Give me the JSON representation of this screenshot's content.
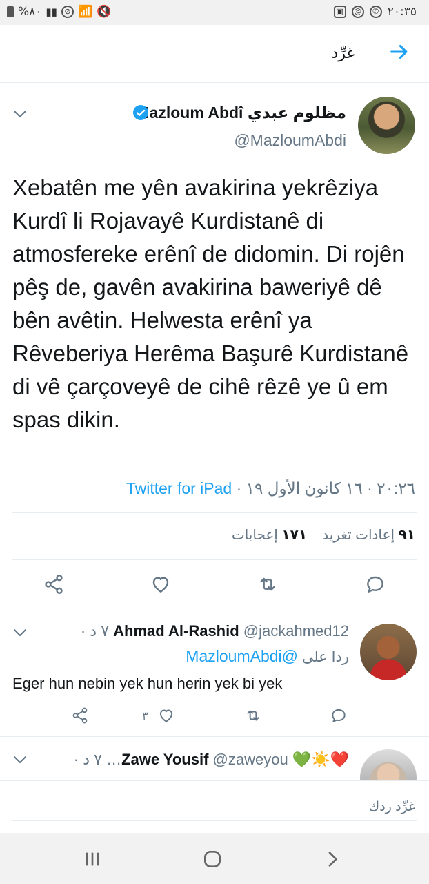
{
  "status_bar": {
    "time": "٢٠:٣٥",
    "battery": "%٨٠",
    "icons": [
      "battery-icon",
      "signal-icon",
      "dnd-icon",
      "wifi-icon",
      "mute-icon",
      "whatsapp-icon",
      "mail-icon",
      "image-icon"
    ]
  },
  "header": {
    "title": "غرِّد"
  },
  "tweet": {
    "author_name": "مظلوم عبدي Mazloum Abdî",
    "handle": "@MazloumAbdi",
    "verified": true,
    "text": "Xebatên me yên avakirina yekrêziya Kurdî li Rojavayê Kurdistanê di atmosfereke erênî de didomin. Di rojên pêş de, gavên avakirina baweriyê dê bên avêtin. Helwesta erênî ya Rêveberiya Herêma Başurê Kurdistanê di vê çarçoveyê de cihê rêzê ye û em spas dikin.",
    "meta_time": "٢٠:٢٦ · ١٦ كانون الأول ١٩ · ",
    "source": "Twitter for iPad",
    "retweets_count": "٩١",
    "retweets_label": "إعادات تغريد",
    "likes_count": "١٧١",
    "likes_label": "إعجابات"
  },
  "replies": [
    {
      "name": "Ahmad Al-Rashid",
      "handle": "@jackahmed12",
      "time": "٧ د ·",
      "replying_label": "ردا على",
      "replying_to": "@MazloumAbdi",
      "text": "Eger hun nebin yek hun herin yek bi yek",
      "like_count": "٣"
    },
    {
      "name": "Zawe Yousif",
      "emojis": "❤️☀️💚",
      "handle": "@zaweyou…",
      "time": "٧ د ·"
    }
  ],
  "compose": {
    "placeholder": "غرِّد ردك"
  },
  "colors": {
    "accent": "#1da1f2",
    "text_primary": "#14171a",
    "text_secondary": "#657786",
    "divider": "#e6ecf0"
  }
}
